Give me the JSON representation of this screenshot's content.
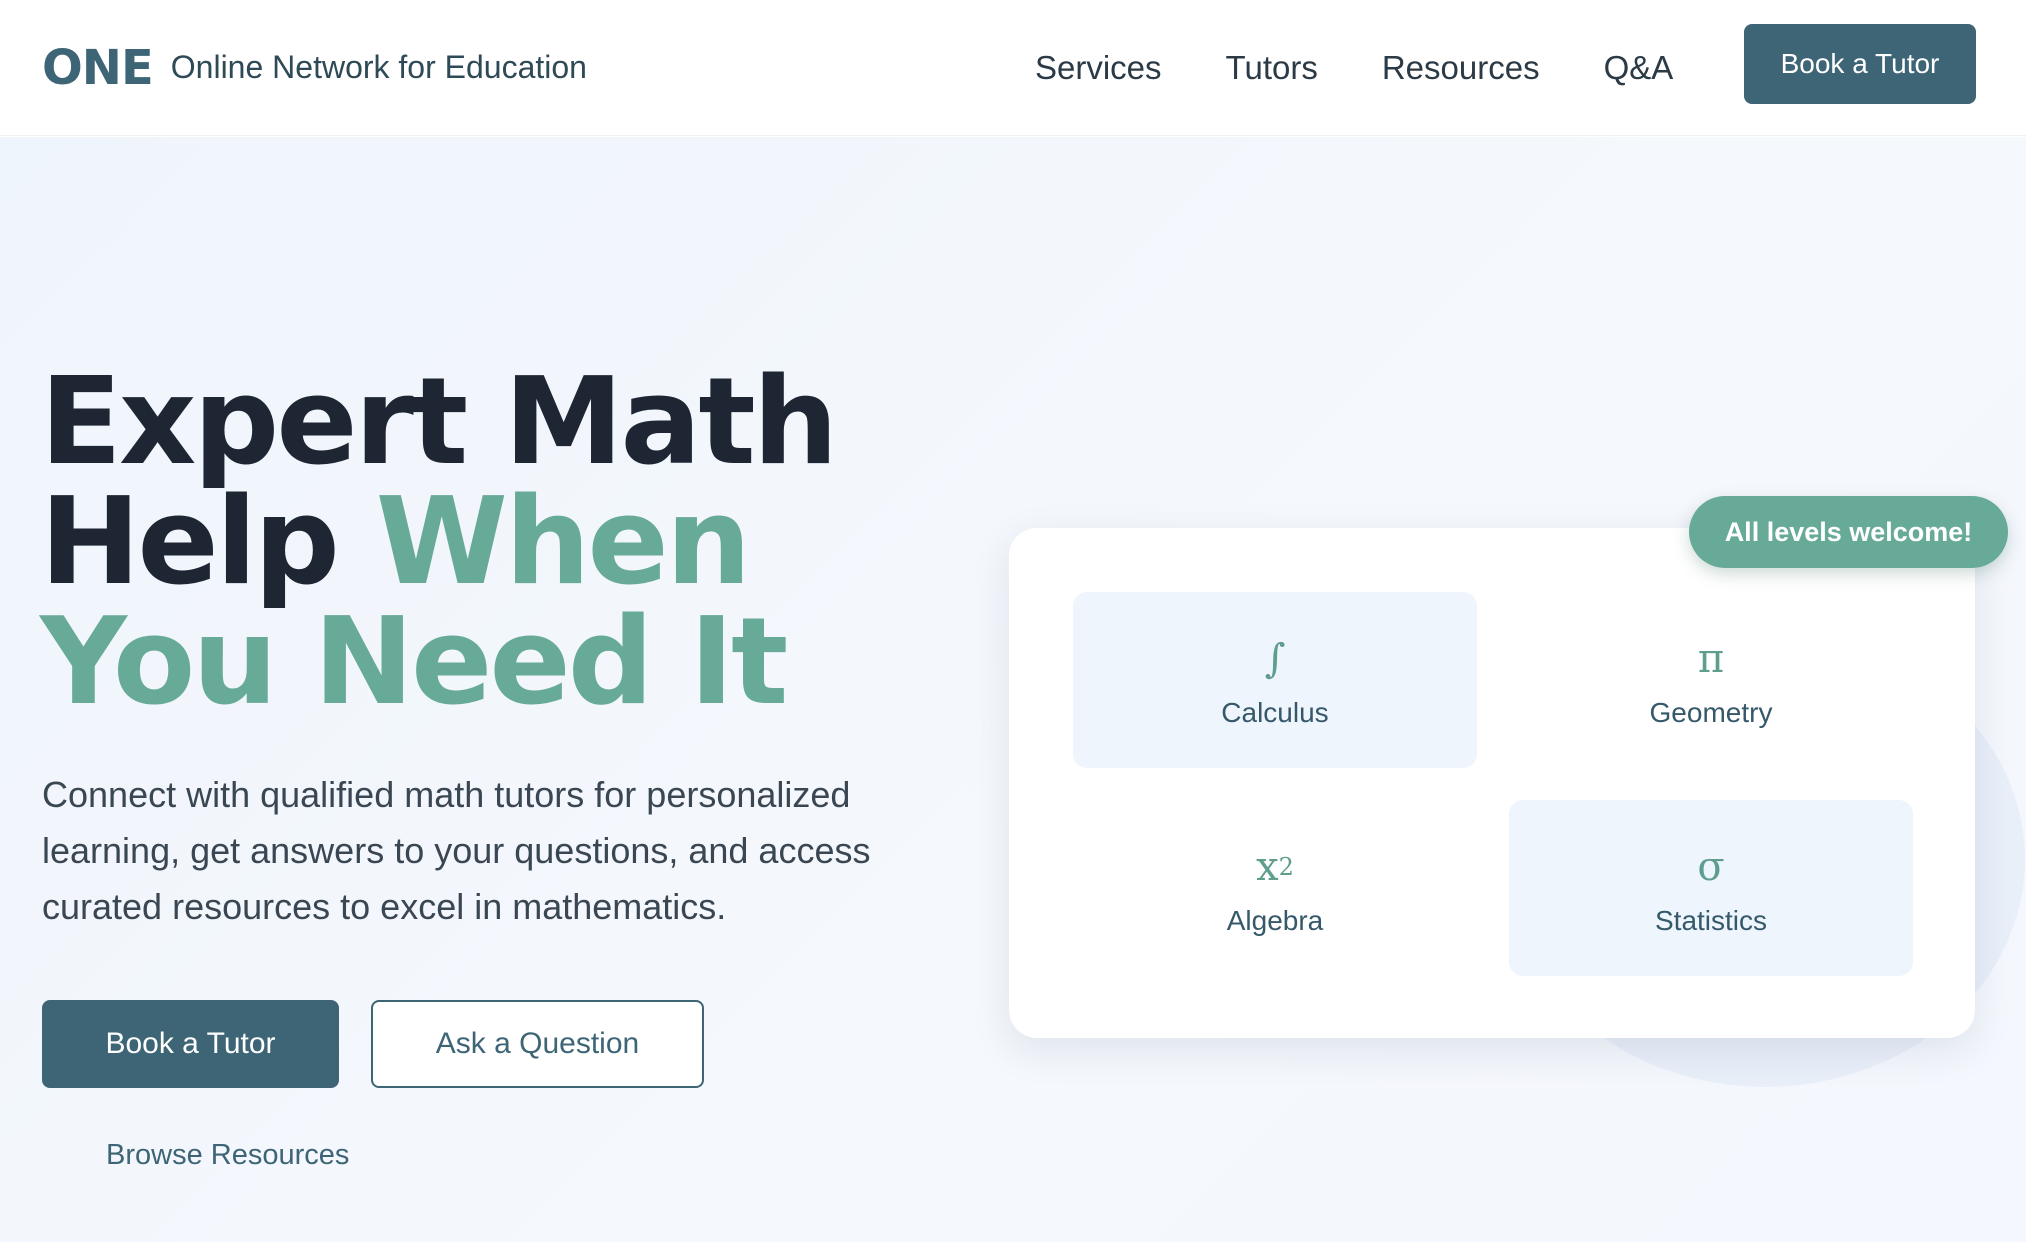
{
  "header": {
    "logo": "ONE",
    "site_name": "Online Network for Education",
    "nav": [
      "Services",
      "Tutors",
      "Resources",
      "Q&A"
    ],
    "cta_label": "Book a Tutor"
  },
  "hero": {
    "title_line1": "Expert Math",
    "title_line2_a": "Help",
    "title_line2_b": "When",
    "title_line3": "You Need It",
    "description": "Connect with qualified math tutors for personalized learning, get answers to your questions, and access curated resources to excel in mathematics.",
    "primary_button": "Book a Tutor",
    "secondary_button": "Ask a Question",
    "link": "Browse Resources"
  },
  "subjects_card": {
    "badge": "All levels welcome!",
    "subjects": [
      {
        "symbol": "∫",
        "label": "Calculus",
        "icon": "integral-icon"
      },
      {
        "symbol": "π",
        "label": "Geometry",
        "icon": "pi-icon"
      },
      {
        "symbol": "x",
        "symbol_sup": "2",
        "label": "Algebra",
        "icon": "x-squared-icon"
      },
      {
        "symbol": "σ",
        "label": "Statistics",
        "icon": "sigma-icon"
      }
    ]
  },
  "colors": {
    "primary": "#3d6576",
    "accent": "#68aa98",
    "heading": "#1e2633",
    "tile_background": "#eef5fd"
  }
}
